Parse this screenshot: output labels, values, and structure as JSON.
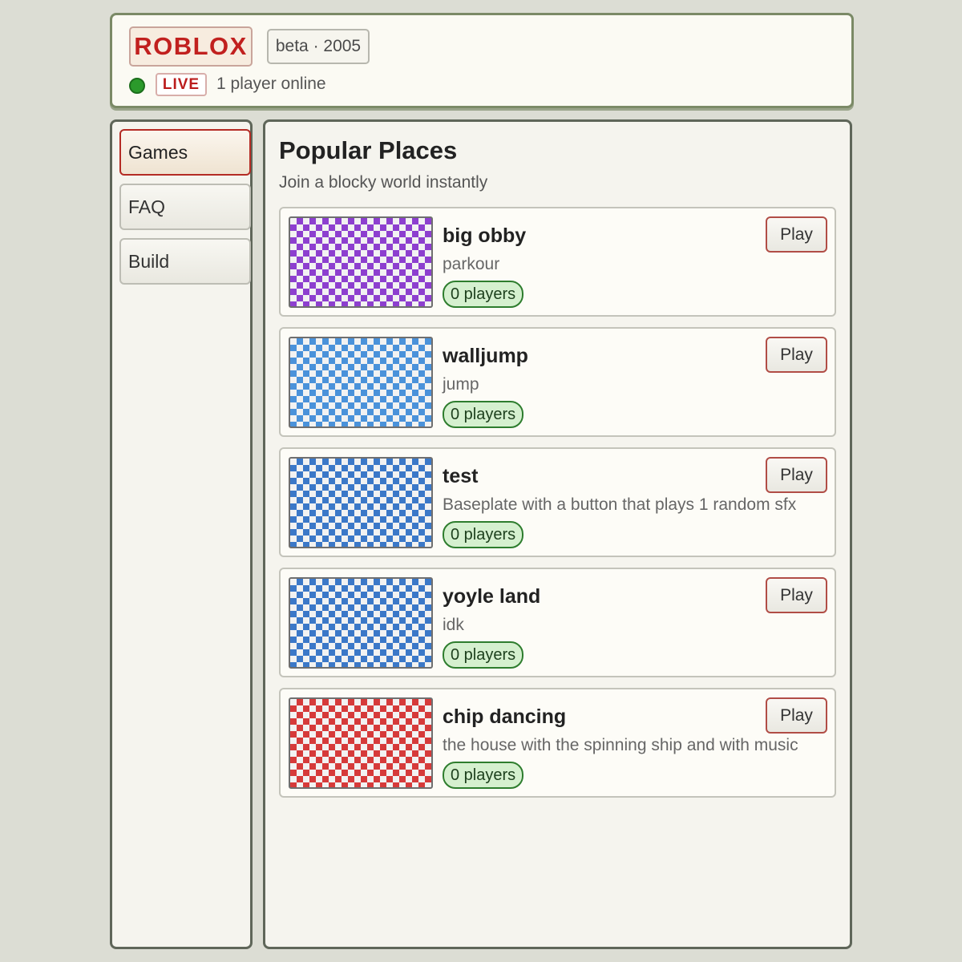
{
  "header": {
    "logo": "ROBLOX",
    "badge": "beta · 2005",
    "live_label": "LIVE",
    "online_text": "1 player online"
  },
  "sidebar": {
    "items": [
      {
        "label": "Games",
        "active": true
      },
      {
        "label": "FAQ",
        "active": false
      },
      {
        "label": "Build",
        "active": false
      }
    ]
  },
  "main": {
    "title": "Popular Places",
    "subtitle": "Join a blocky world instantly",
    "play_label": "Play",
    "games": [
      {
        "title": "big obby",
        "description": "parkour",
        "players": "0 players",
        "color": "#8d3fcf"
      },
      {
        "title": "walljump",
        "description": "jump",
        "players": "0 players",
        "color": "#4a92da"
      },
      {
        "title": "test",
        "description": "Baseplate with a button that plays 1 random sfx",
        "players": "0 players",
        "color": "#3b78c8"
      },
      {
        "title": "yoyle land",
        "description": "idk",
        "players": "0 players",
        "color": "#3b78c8"
      },
      {
        "title": "chip dancing",
        "description": "the house with the spinning ship and with music",
        "players": "0 players",
        "color": "#d63a3a"
      }
    ]
  },
  "colors": {
    "accent_red": "#c1201e",
    "live_green": "#2b9a2b",
    "panel_border": "#5f6659"
  }
}
